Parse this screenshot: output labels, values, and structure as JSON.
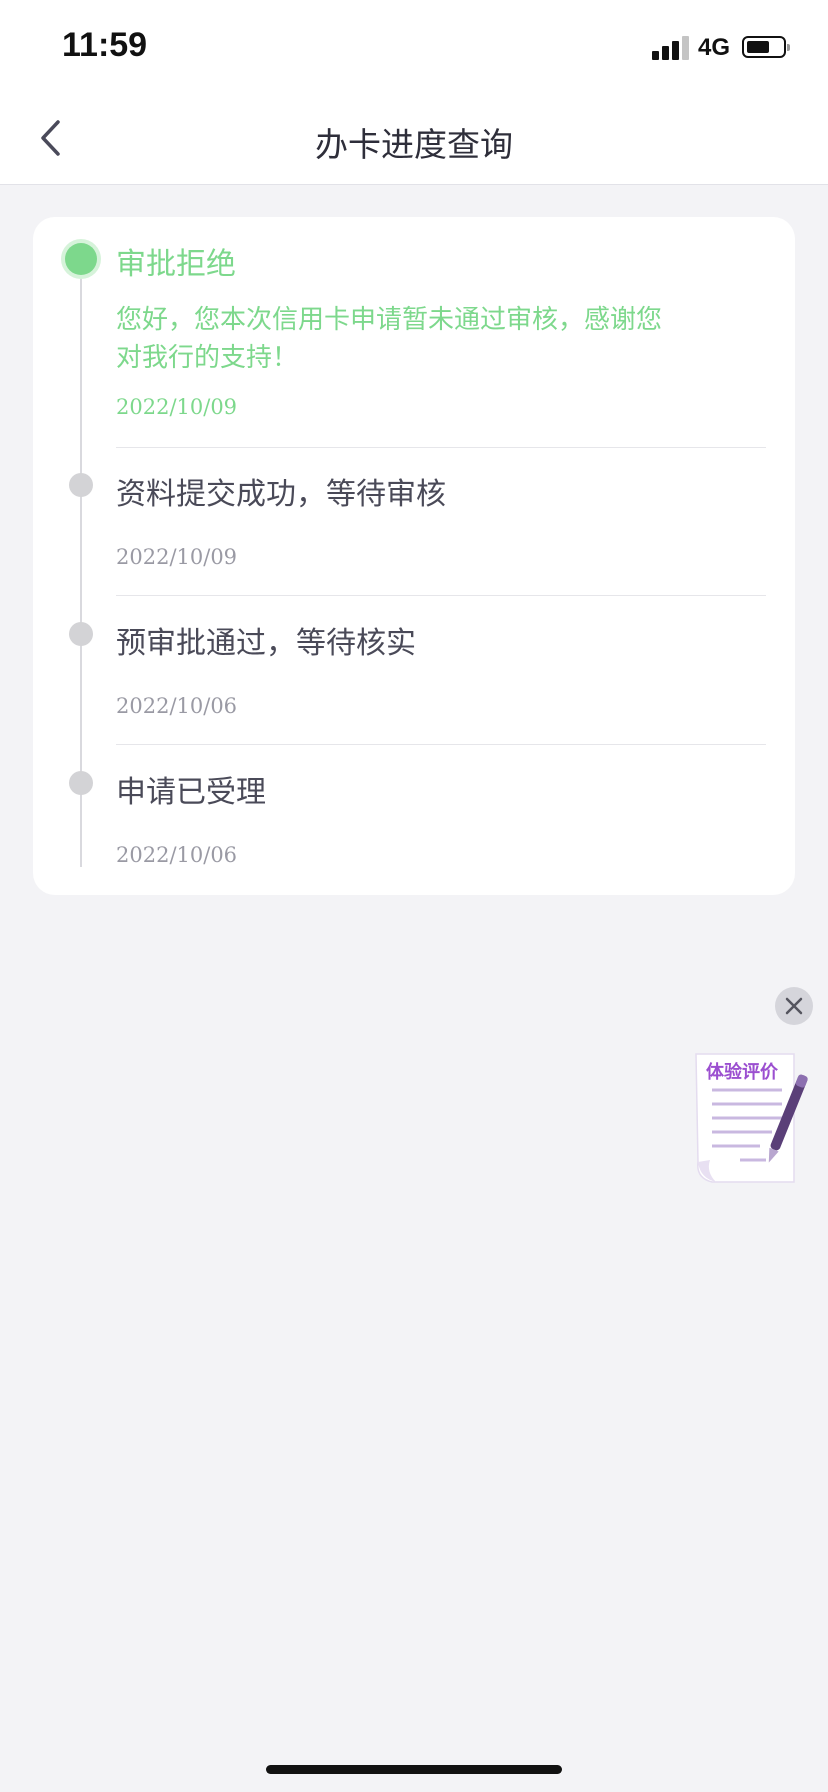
{
  "status_bar": {
    "time": "11:59",
    "network": "4G",
    "battery_level_percent": 60
  },
  "nav": {
    "title": "办卡进度查询",
    "back_icon": "chevron-left-icon"
  },
  "timeline": {
    "steps": [
      {
        "title": "审批拒绝",
        "message": "您好，您本次信用卡申请暂未通过审核，感谢您对我行的支持！",
        "date": "2022/10/09",
        "status": "current"
      },
      {
        "title": "资料提交成功，等待审核",
        "date": "2022/10/09",
        "status": "done"
      },
      {
        "title": "预审批通过，等待核实",
        "date": "2022/10/06",
        "status": "done"
      },
      {
        "title": "申请已受理",
        "date": "2022/10/06",
        "status": "done"
      }
    ]
  },
  "floating": {
    "close_icon": "close-icon",
    "feedback_label": "体验评价",
    "feedback_icon": "pen-document-icon"
  },
  "colors": {
    "accent_green": "#7dd88c",
    "feedback_purple": "#9b4fd0",
    "background": "#f3f3f6"
  }
}
